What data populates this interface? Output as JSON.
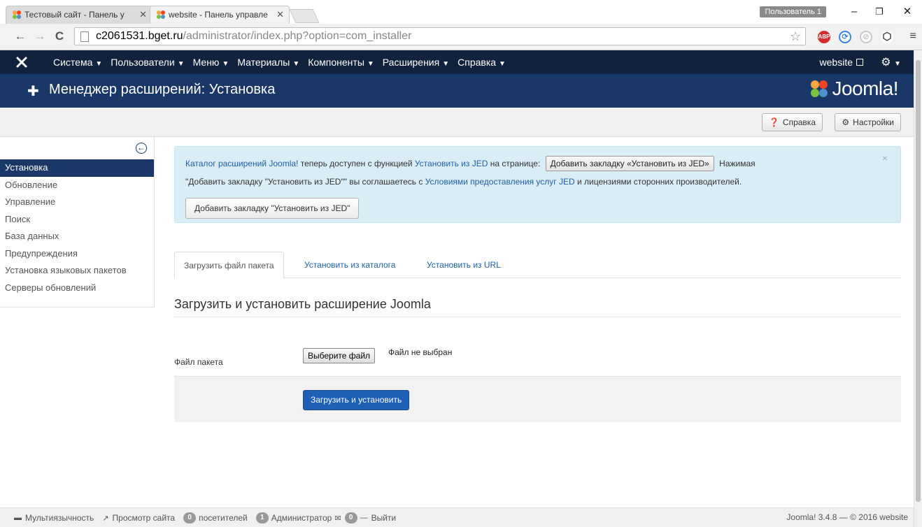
{
  "browser": {
    "tabs": [
      {
        "title": "Тестовый сайт - Панель у",
        "active": false
      },
      {
        "title": "website - Панель управле",
        "active": true
      }
    ],
    "user_badge": "Пользователь 1",
    "url_host": "c2061531.bget.ru",
    "url_path": "/administrator/index.php?option=com_installer",
    "extensions": [
      {
        "name": "abp-icon",
        "label": "ABP",
        "color": "#d42d2d"
      },
      {
        "name": "sync-icon",
        "label": "",
        "color": "#3b83e0"
      },
      {
        "name": "compass-icon",
        "label": "",
        "color": "#c8c8c8"
      },
      {
        "name": "cube-icon",
        "label": "",
        "color": "#444444"
      }
    ]
  },
  "admin_nav": {
    "menu": [
      {
        "label": "Система"
      },
      {
        "label": "Пользователи"
      },
      {
        "label": "Меню"
      },
      {
        "label": "Материалы"
      },
      {
        "label": "Компоненты"
      },
      {
        "label": "Расширения"
      },
      {
        "label": "Справка"
      }
    ],
    "site_link": "website"
  },
  "header": {
    "title": "Менеджер расширений: Установка",
    "brand": "Joomla!"
  },
  "toolbar": {
    "help_label": "Справка",
    "options_label": "Настройки"
  },
  "sidebar": {
    "items": [
      {
        "label": "Установка",
        "active": true
      },
      {
        "label": "Обновление",
        "active": false
      },
      {
        "label": "Управление",
        "active": false
      },
      {
        "label": "Поиск",
        "active": false
      },
      {
        "label": "База данных",
        "active": false
      },
      {
        "label": "Предупреждения",
        "active": false
      },
      {
        "label": "Установка языковых пакетов",
        "active": false
      },
      {
        "label": "Серверы обновлений",
        "active": false
      }
    ]
  },
  "alert": {
    "link_catalog": "Каталог расширений Joomla!",
    "text_1": " теперь доступен с функцией ",
    "link_install_jed": "Установить из JED",
    "text_2": " на странице: ",
    "inline_button": "Добавить закладку «Установить из JED»",
    "text_3": " Нажимая",
    "line2_start": "\"Добавить закладку \"Установить из JED\"\" вы соглашаетесь с ",
    "link_terms": "Условиями предоставления услуг JED",
    "line2_end": " и лицензиями сторонних производителей.",
    "button": "Добавить закладку \"Установить из JED\"",
    "close": "×"
  },
  "tabs": [
    {
      "label": "Загрузить файл пакета",
      "active": true
    },
    {
      "label": "Установить из каталога",
      "active": false
    },
    {
      "label": "Установить из URL",
      "active": false
    }
  ],
  "upload": {
    "section_title": "Загрузить и установить расширение Joomla",
    "field_label": "Файл пакета",
    "file_button": "Выберите файл",
    "no_file": "Файл не выбран",
    "submit": "Загрузить и установить"
  },
  "status": {
    "multilang": "Мультиязычность",
    "view_site": "Просмотр сайта",
    "visitors_count": "0",
    "visitors_label": "посетителей",
    "admins_count": "1",
    "admins_label": "Администратор",
    "messages_count": "0",
    "logout": "Выйти",
    "version": "Joomla! 3.4.8 — © 2016 website"
  },
  "colors": {
    "nav_bg": "#10223e",
    "header_bg": "#1a3867",
    "primary": "#1d60b6",
    "alert_bg": "#d9edf7"
  }
}
